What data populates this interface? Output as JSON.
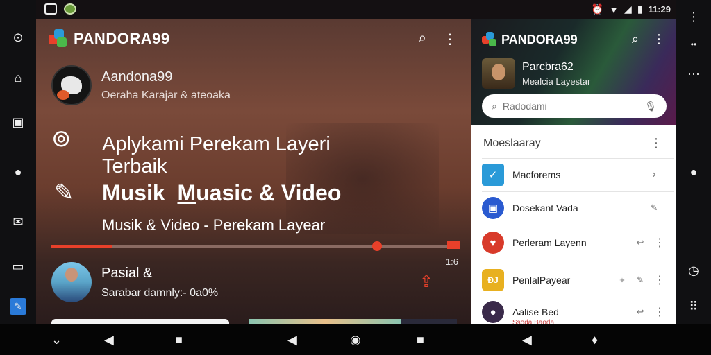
{
  "status_bar": {
    "time": "11:29",
    "icons": [
      "image-icon",
      "green-app-icon",
      "alarm-icon",
      "wifi-icon",
      "signal-icon",
      "battery-icon"
    ]
  },
  "left_rail": {
    "icons": [
      "camera-icon",
      "home-icon",
      "tv-icon",
      "record-dot-icon",
      "mail-icon",
      "video-icon",
      "app-icon"
    ]
  },
  "right_rail": {
    "icons": [
      "more-vert-icon",
      "dots-icon",
      "dots-horizontal-icon",
      "record-dot-icon",
      "clock-icon",
      "grid-icon"
    ]
  },
  "main": {
    "brand": "PANDORA99",
    "profile": {
      "name": "Aandona99",
      "subtitle": "Oeraha Karajar & ateoaka"
    },
    "hero": {
      "line1": "Aplykami Perekam Layeri",
      "line1b": "Terbaik",
      "line2a": "Musik",
      "line2b": "M",
      "line2c": "uasic & Video",
      "line3": "Musik & Video - Perekam Layear"
    },
    "progress": {
      "played_fraction": 0.15,
      "knob_fraction": 0.8,
      "time": "1:6"
    },
    "track": {
      "title": "Pasial &",
      "subtitle": "Sarabar damnly:- 0a0%"
    }
  },
  "side": {
    "brand": "PANDORA99",
    "user": {
      "name": "Parcbra62",
      "subtitle": "Mealcia Layestar"
    },
    "search": {
      "placeholder": "Radodami"
    },
    "section_title": "Moeslaaray",
    "items": [
      {
        "label": "Macforems",
        "color": "#2a9ad8",
        "glyph": "✓"
      },
      {
        "label": "Dosekant Vada",
        "color": "#2a5ad0",
        "glyph": "▣"
      },
      {
        "label": "Perleram Layenn",
        "color": "#d83a2a",
        "glyph": "♥"
      },
      {
        "label": "PenlalPayear",
        "color": "#e8b020",
        "glyph": "ÐJ"
      },
      {
        "label": "Aalise Bed",
        "sub": "Ssoda Baoda",
        "color": "#3a2a4a",
        "glyph": "●"
      }
    ]
  }
}
